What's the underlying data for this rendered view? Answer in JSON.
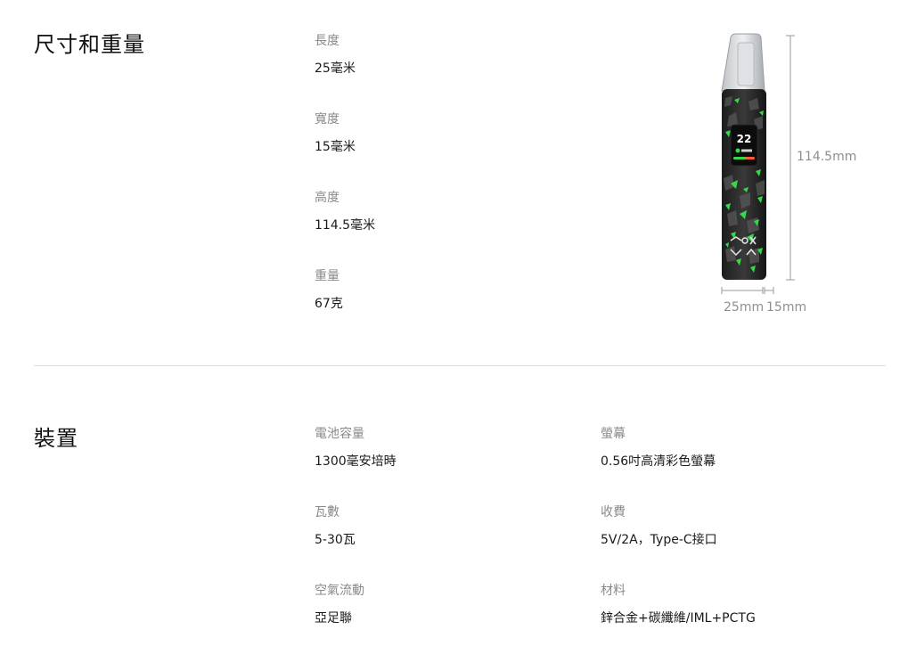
{
  "dimensions": {
    "title": "尺寸和重量",
    "specs": [
      {
        "label": "長度",
        "value": "25毫米"
      },
      {
        "label": "寬度",
        "value": "15毫米"
      },
      {
        "label": "高度",
        "value": "114.5毫米"
      },
      {
        "label": "重量",
        "value": "67克"
      }
    ],
    "figure": {
      "height_label": "114.5mm",
      "length_label": "25mm",
      "width_label": "15mm",
      "screen": {
        "time": "22",
        "accent": "#36d94a"
      }
    }
  },
  "device": {
    "title": "裝置",
    "specs": [
      {
        "label": "電池容量",
        "value": "1300毫安培時"
      },
      {
        "label": "螢幕",
        "value": "0.56吋高清彩色螢幕"
      },
      {
        "label": "瓦數",
        "value": "5-30瓦"
      },
      {
        "label": "收費",
        "value": "5V/2A，Type-C接口"
      },
      {
        "label": "空氣流動",
        "value": "亞足聯"
      },
      {
        "label": "材料",
        "value": "鋅合金+碳纖維/IML+PCTG"
      }
    ]
  },
  "colors": {
    "label": "#8a8a8a",
    "value": "#1a1a1a",
    "divider": "#dcdcdc",
    "device_accent": "#36d94a"
  }
}
